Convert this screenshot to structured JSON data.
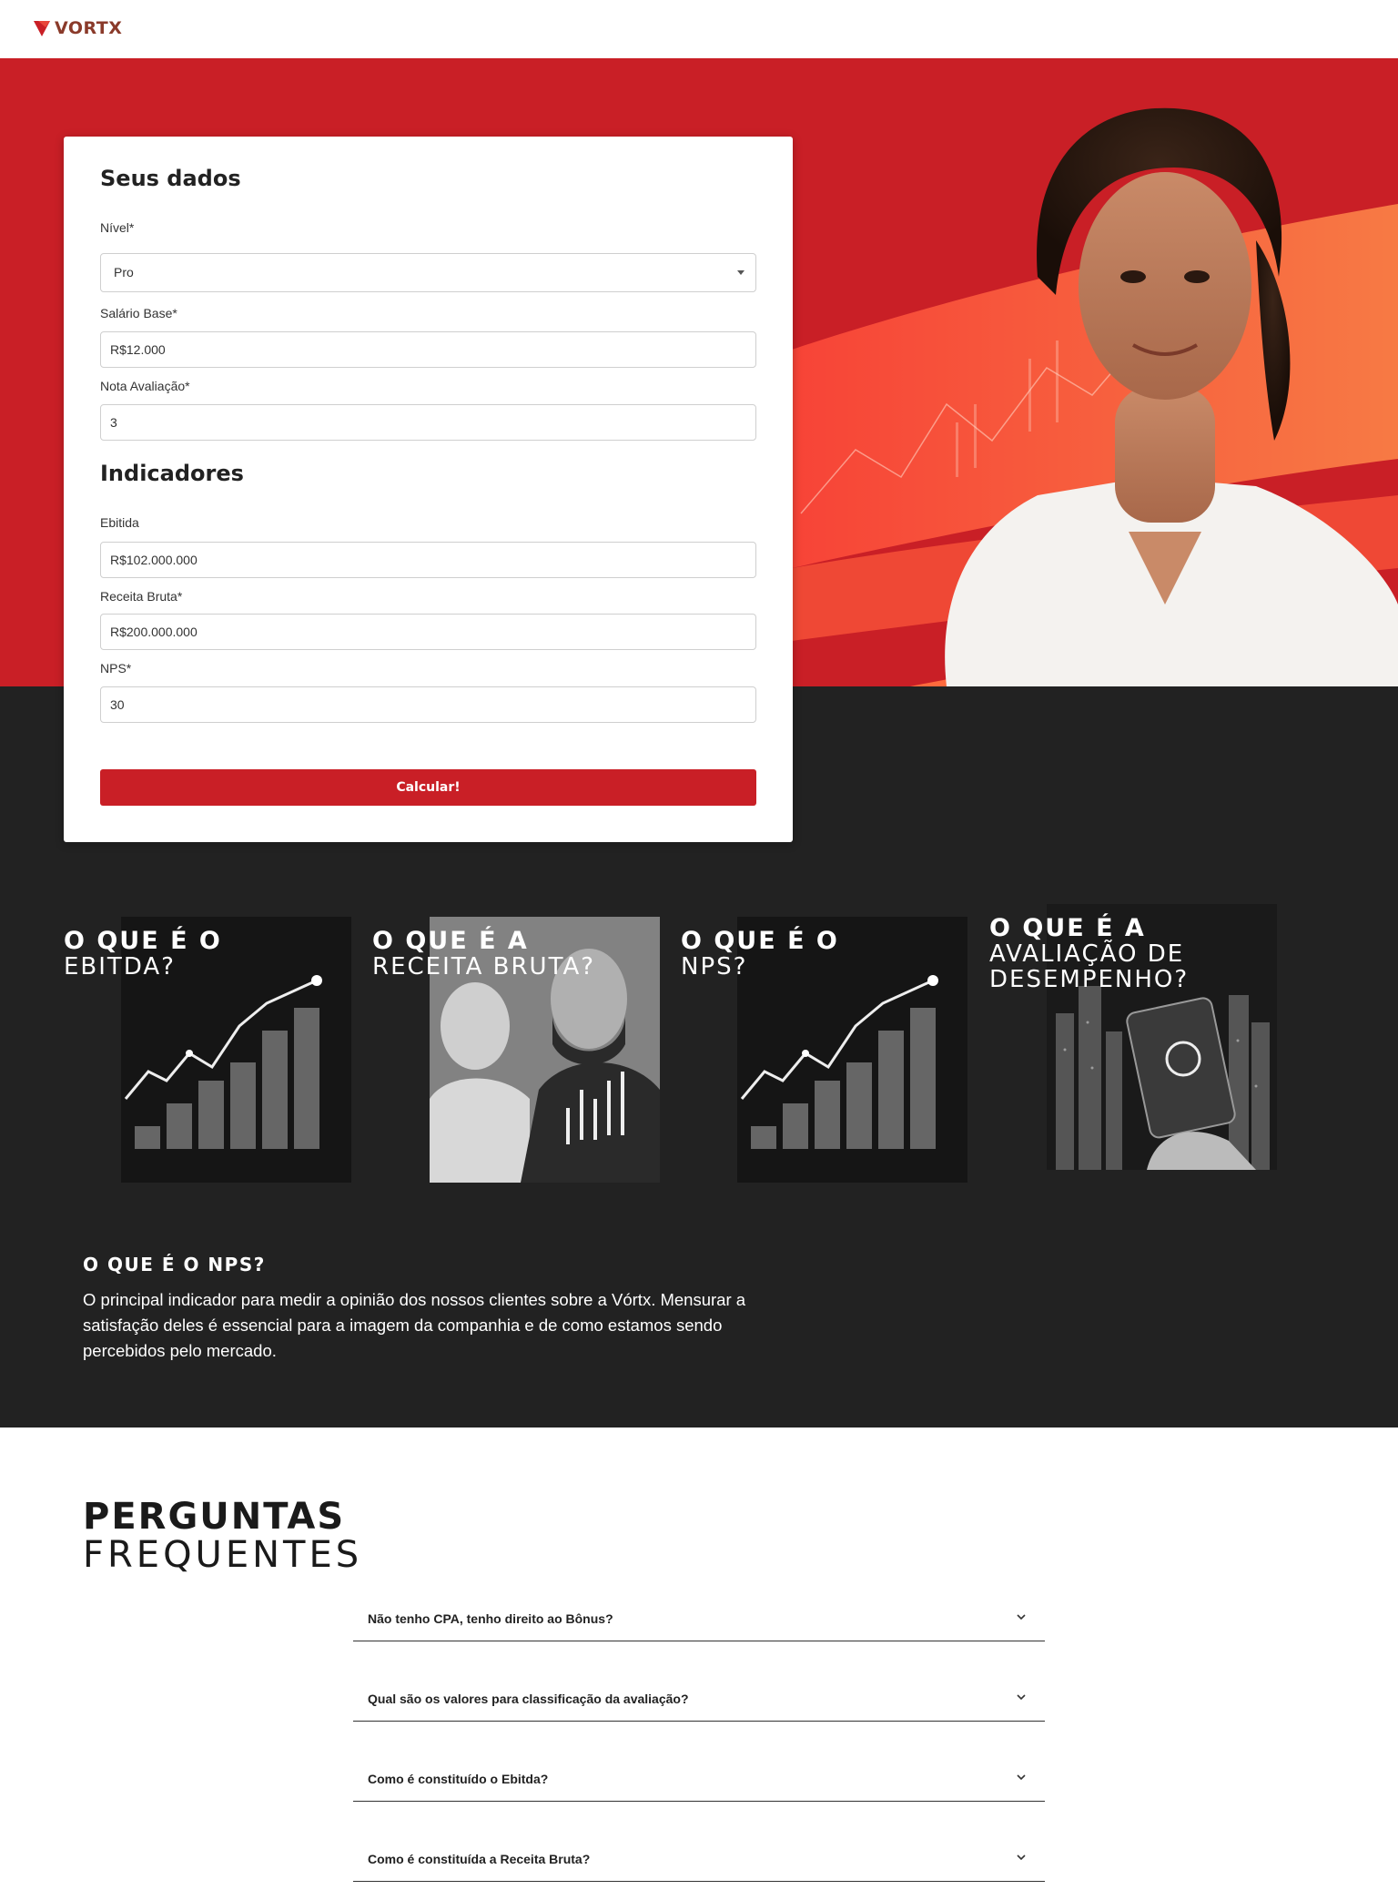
{
  "header": {
    "logo_text": "VORTX",
    "logo_icon": "vortx-logo-icon"
  },
  "form": {
    "title": "Seus dados",
    "nivel_label": "Nível*",
    "nivel_value": "Pro",
    "salario_label": "Salário Base*",
    "salario_value": "R$12.000",
    "nota_label": "Nota Avaliação*",
    "nota_value": "3",
    "indicadores_title": "Indicadores",
    "ebitda_label": "Ebitida",
    "ebitda_value": "R$102.000.000",
    "receita_label": "Receita Bruta*",
    "receita_value": "R$200.000.000",
    "nps_label": "NPS*",
    "nps_value": "30",
    "submit_label": "Calcular!"
  },
  "tiles": [
    {
      "l1": "O QUE É O",
      "l2": "EBITDA?"
    },
    {
      "l1": "O QUE É A",
      "l2": "RECEITA BRUTA?"
    },
    {
      "l1": "O QUE É O",
      "l2": "NPS?"
    },
    {
      "l1": "O QUE É A",
      "l2a": "AVALIAÇÃO DE",
      "l2b": "DESEMPENHO?"
    }
  ],
  "nps_info": {
    "title": "O QUE É O NPS?",
    "text": "O principal indicador para medir a opinião dos nossos clientes sobre a Vórtx. Mensurar a satisfação deles é essencial para a imagem da companhia e de como estamos sendo percebidos pelo mercado."
  },
  "faq": {
    "title_bold": "PERGUNTAS",
    "title_thin": "FREQUENTES",
    "items": [
      {
        "q": "Não tenho CPA, tenho direito ao Bônus?"
      },
      {
        "q": "Qual são os valores para classificação da avaliação?"
      },
      {
        "q": "Como é constituído o Ebitda?"
      },
      {
        "q": "Como é constituída a Receita Bruta?"
      }
    ]
  },
  "colors": {
    "brand_red": "#c91f26",
    "dark_bg": "#222222",
    "accent_orange": "#ff6a3d"
  }
}
